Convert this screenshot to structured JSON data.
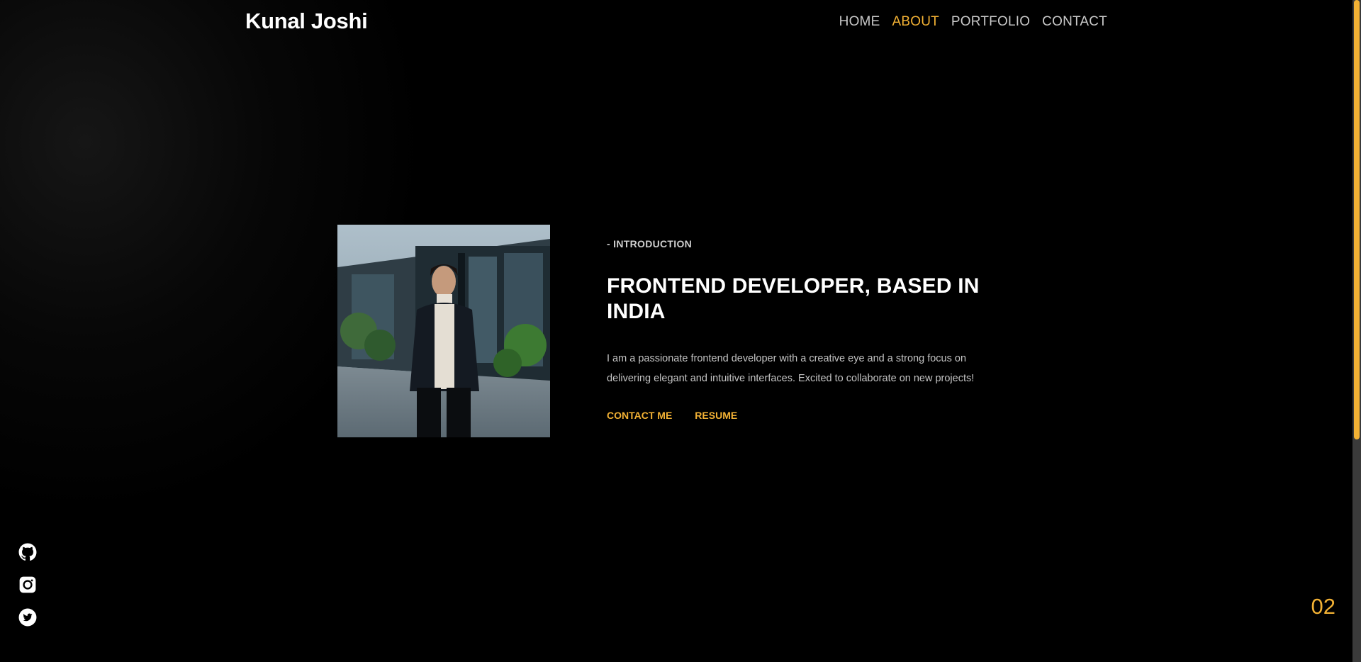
{
  "header": {
    "brand": "Kunal Joshi",
    "nav": [
      {
        "label": "HOME",
        "active": false
      },
      {
        "label": "ABOUT",
        "active": true
      },
      {
        "label": "PORTFOLIO",
        "active": false
      },
      {
        "label": "CONTACT",
        "active": false
      }
    ]
  },
  "about": {
    "eyebrow": "- INTRODUCTION",
    "headline": "FRONTEND DEVELOPER, BASED IN INDIA",
    "bio": "I am a passionate frontend developer with a creative eye and a strong focus on delivering elegant and intuitive interfaces. Excited to collaborate on new projects!",
    "actions": {
      "contact_label": "CONTACT ME",
      "resume_label": "RESUME"
    },
    "photo_icon": "profile-photo"
  },
  "socials": [
    {
      "icon": "github-icon"
    },
    {
      "icon": "instagram-icon"
    },
    {
      "icon": "twitter-icon"
    }
  ],
  "page_number": "02",
  "colors": {
    "accent": "#f2b134",
    "background": "#000000",
    "text_primary": "#ffffff",
    "text_secondary": "#c4c4c4"
  }
}
